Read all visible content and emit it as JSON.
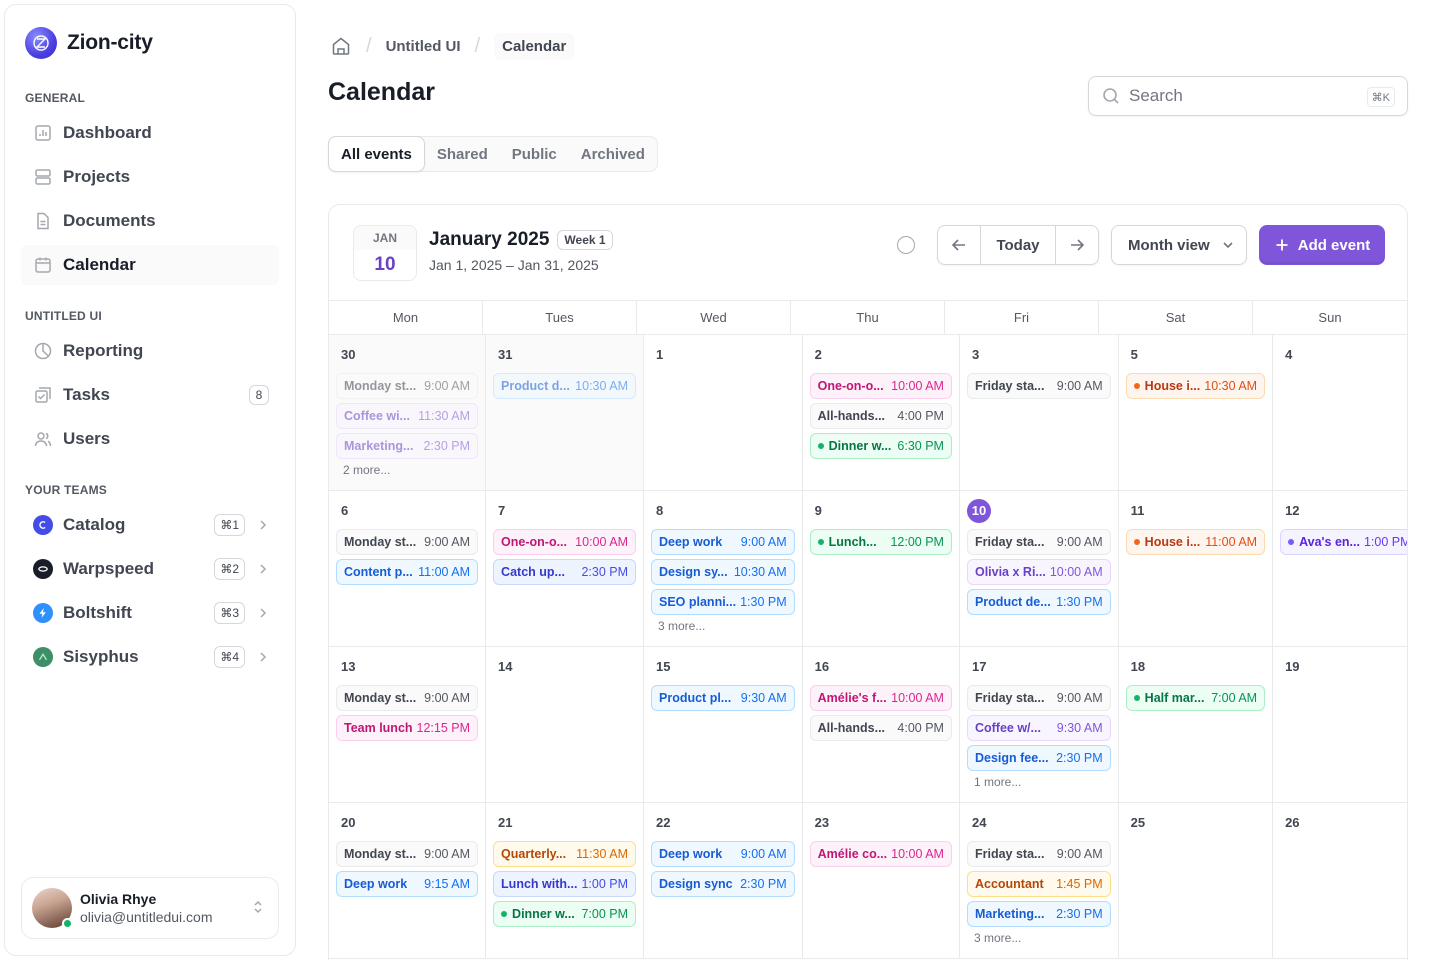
{
  "app": {
    "name": "Zion-city"
  },
  "sidebar": {
    "general_label": "GENERAL",
    "general": [
      {
        "label": "Dashboard",
        "icon": "bar-chart-icon"
      },
      {
        "label": "Projects",
        "icon": "rows-icon"
      },
      {
        "label": "Documents",
        "icon": "file-icon"
      },
      {
        "label": "Calendar",
        "icon": "calendar-icon",
        "active": true
      }
    ],
    "untitled_label": "UNTITLED UI",
    "untitled": [
      {
        "label": "Reporting",
        "icon": "pie-chart-icon"
      },
      {
        "label": "Tasks",
        "icon": "check-square-icon",
        "badge": "8"
      },
      {
        "label": "Users",
        "icon": "users-icon"
      }
    ],
    "teams_label": "YOUR TEAMS",
    "teams": [
      {
        "label": "Catalog",
        "kbd": "⌘1",
        "color": "#444ce7"
      },
      {
        "label": "Warpspeed",
        "kbd": "⌘2",
        "color": "#181d27"
      },
      {
        "label": "Boltshift",
        "kbd": "⌘3",
        "color": "#2e90fa"
      },
      {
        "label": "Sisyphus",
        "kbd": "⌘4",
        "color": "#3e8e6a"
      }
    ],
    "user": {
      "name": "Olivia Rhye",
      "email": "olivia@untitledui.com"
    }
  },
  "header": {
    "breadcrumb": [
      "Untitled UI",
      "Calendar"
    ],
    "title": "Calendar",
    "search_placeholder": "Search",
    "search_kbd": "⌘K",
    "tabs": [
      "All events",
      "Shared",
      "Public",
      "Archived"
    ],
    "active_tab": 0
  },
  "calendar": {
    "date_month": "JAN",
    "date_day": "10",
    "title": "January 2025",
    "week_badge": "Week 1",
    "range": "Jan 1, 2025 – Jan 31, 2025",
    "today_label": "Today",
    "view_label": "Month view",
    "add_label": "Add event",
    "weekdays": [
      "Mon",
      "Tues",
      "Wed",
      "Thu",
      "Fri",
      "Sat",
      "Sun"
    ],
    "days": [
      {
        "n": "30",
        "muted": true,
        "events": [
          {
            "name": "Monday st...",
            "time": "9:00 AM",
            "color": "gray",
            "faded": true
          },
          {
            "name": "Coffee wi...",
            "time": "11:30 AM",
            "color": "brand",
            "faded": true
          },
          {
            "name": "Marketing...",
            "time": "2:30 PM",
            "color": "brand",
            "faded": true
          }
        ],
        "more": "2 more..."
      },
      {
        "n": "31",
        "muted": true,
        "events": [
          {
            "name": "Product d...",
            "time": "10:30 AM",
            "color": "blue",
            "faded": true
          }
        ]
      },
      {
        "n": "1",
        "events": []
      },
      {
        "n": "2",
        "events": [
          {
            "name": "One-on-o...",
            "time": "10:00 AM",
            "color": "pink"
          },
          {
            "name": "All-hands...",
            "time": "4:00 PM",
            "color": "gray"
          },
          {
            "name": "Dinner w...",
            "time": "6:30 PM",
            "color": "green",
            "dot": true
          }
        ]
      },
      {
        "n": "3",
        "events": [
          {
            "name": "Friday sta...",
            "time": "9:00 AM",
            "color": "gray"
          }
        ]
      },
      {
        "n": "5",
        "events": [
          {
            "name": "House i...",
            "time": "10:30 AM",
            "color": "orange",
            "dot": true
          }
        ]
      },
      {
        "n": "4",
        "events": []
      },
      {
        "n": "6",
        "events": [
          {
            "name": "Monday st...",
            "time": "9:00 AM",
            "color": "gray"
          },
          {
            "name": "Content p...",
            "time": "11:00 AM",
            "color": "blue"
          }
        ]
      },
      {
        "n": "7",
        "events": [
          {
            "name": "One-on-o...",
            "time": "10:00 AM",
            "color": "pink"
          },
          {
            "name": "Catch up...",
            "time": "2:30 PM",
            "color": "indigo"
          }
        ]
      },
      {
        "n": "8",
        "events": [
          {
            "name": "Deep work",
            "time": "9:00 AM",
            "color": "blue"
          },
          {
            "name": "Design sy...",
            "time": "10:30 AM",
            "color": "blue"
          },
          {
            "name": "SEO planni...",
            "time": "1:30 PM",
            "color": "blue"
          }
        ],
        "more": "3 more..."
      },
      {
        "n": "9",
        "events": [
          {
            "name": "Lunch...",
            "time": "12:00 PM",
            "color": "green",
            "dot": true
          }
        ]
      },
      {
        "n": "10",
        "today": true,
        "events": [
          {
            "name": "Friday sta...",
            "time": "9:00 AM",
            "color": "gray"
          },
          {
            "name": "Olivia x Ri...",
            "time": "10:00 AM",
            "color": "brand"
          },
          {
            "name": "Product de...",
            "time": "1:30 PM",
            "color": "blue"
          }
        ]
      },
      {
        "n": "11",
        "events": [
          {
            "name": "House i...",
            "time": "11:00 AM",
            "color": "orange",
            "dot": true
          }
        ]
      },
      {
        "n": "12",
        "events": [
          {
            "name": "Ava's en...",
            "time": "1:00 PM",
            "color": "purple",
            "dot": true
          }
        ]
      },
      {
        "n": "13",
        "events": [
          {
            "name": "Monday st...",
            "time": "9:00 AM",
            "color": "gray"
          },
          {
            "name": "Team lunch",
            "time": "12:15 PM",
            "color": "pink"
          }
        ]
      },
      {
        "n": "14",
        "events": []
      },
      {
        "n": "15",
        "events": [
          {
            "name": "Product pl...",
            "time": "9:30 AM",
            "color": "blue"
          }
        ]
      },
      {
        "n": "16",
        "events": [
          {
            "name": "Amélie's f...",
            "time": "10:00 AM",
            "color": "pink"
          },
          {
            "name": "All-hands...",
            "time": "4:00 PM",
            "color": "gray"
          }
        ]
      },
      {
        "n": "17",
        "events": [
          {
            "name": "Friday sta...",
            "time": "9:00 AM",
            "color": "gray"
          },
          {
            "name": "Coffee w/...",
            "time": "9:30 AM",
            "color": "brand"
          },
          {
            "name": "Design fee...",
            "time": "2:30 PM",
            "color": "blue"
          }
        ],
        "more": "1 more..."
      },
      {
        "n": "18",
        "events": [
          {
            "name": "Half mar...",
            "time": "7:00 AM",
            "color": "green",
            "dot": true
          }
        ]
      },
      {
        "n": "19",
        "events": []
      },
      {
        "n": "20",
        "events": [
          {
            "name": "Monday st...",
            "time": "9:00 AM",
            "color": "gray"
          },
          {
            "name": "Deep work",
            "time": "9:15 AM",
            "color": "blue"
          }
        ]
      },
      {
        "n": "21",
        "events": [
          {
            "name": "Quarterly...",
            "time": "11:30 AM",
            "color": "yellow"
          },
          {
            "name": "Lunch with...",
            "time": "1:00 PM",
            "color": "indigo"
          },
          {
            "name": "Dinner w...",
            "time": "7:00 PM",
            "color": "green",
            "dot": true
          }
        ]
      },
      {
        "n": "22",
        "events": [
          {
            "name": "Deep work",
            "time": "9:00 AM",
            "color": "blue"
          },
          {
            "name": "Design sync",
            "time": "2:30 PM",
            "color": "blue"
          }
        ]
      },
      {
        "n": "23",
        "events": [
          {
            "name": "Amélie co...",
            "time": "10:00 AM",
            "color": "pink"
          }
        ]
      },
      {
        "n": "24",
        "events": [
          {
            "name": "Friday sta...",
            "time": "9:00 AM",
            "color": "gray"
          },
          {
            "name": "Accountant",
            "time": "1:45 PM",
            "color": "yellow"
          },
          {
            "name": "Marketing...",
            "time": "2:30 PM",
            "color": "blue"
          }
        ],
        "more": "3 more..."
      },
      {
        "n": "25",
        "events": []
      },
      {
        "n": "26",
        "events": []
      }
    ]
  }
}
